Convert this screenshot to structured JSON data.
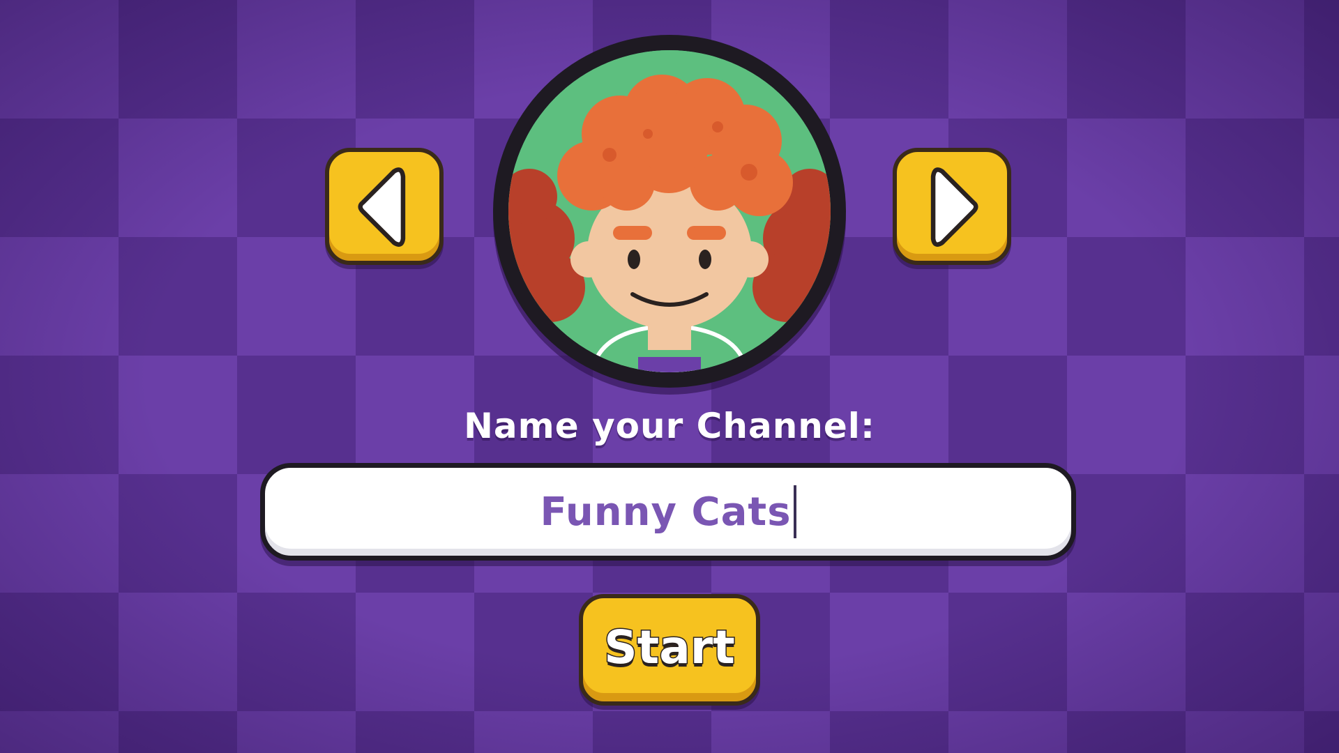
{
  "avatar": {
    "description_icon": "curly-red-hair-avatar",
    "background_color": "#5dbf7f",
    "hair_color": "#e8703a"
  },
  "navigation": {
    "prev_icon": "left-arrow-icon",
    "next_icon": "right-arrow-icon"
  },
  "form": {
    "label": "Name your Channel:",
    "channel_name_value": "Funny Cats"
  },
  "actions": {
    "start_label": "Start"
  },
  "colors": {
    "background_dark": "#57308f",
    "background_light": "#6b3fa8",
    "button_yellow": "#f6c21f",
    "input_text": "#7a56b3"
  }
}
